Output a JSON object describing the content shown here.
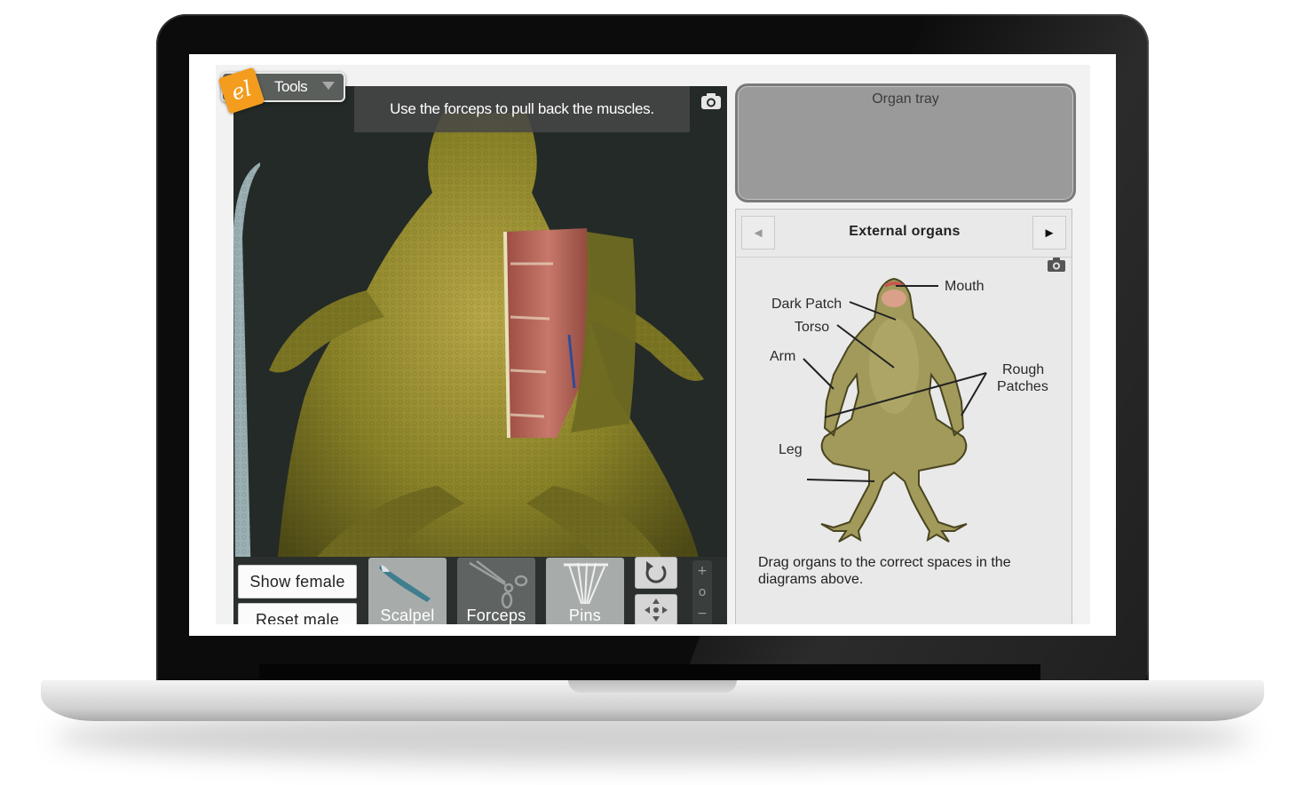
{
  "toolbar": {
    "tools_label": "Tools",
    "logo_text": "el"
  },
  "viewport": {
    "instruction": "Use the forceps to pull back the muscles.",
    "icons": {
      "camera": "camera-icon"
    }
  },
  "controls": {
    "show_female": "Show female",
    "reset_male": "Reset male",
    "tools": [
      {
        "label": "Scalpel",
        "icon": "scalpel-icon"
      },
      {
        "label": "Forceps",
        "icon": "forceps-icon"
      },
      {
        "label": "Pins",
        "icon": "pins-icon"
      }
    ],
    "zoom": {
      "plus": "+",
      "reset": "o",
      "minus": "−"
    }
  },
  "organ_tray": {
    "title": "Organ tray"
  },
  "diagram": {
    "title": "External organs",
    "prev_icon": "◄",
    "next_icon": "►",
    "labels": {
      "mouth": "Mouth",
      "dark_patch": "Dark Patch",
      "torso": "Torso",
      "arm": "Arm",
      "rough_line1": "Rough",
      "rough_line2": "Patches",
      "leg": "Leg"
    },
    "hint": "Drag organs to the correct spaces in the diagrams above."
  },
  "colors": {
    "frog_skin": "#8f8a2e",
    "diagram_frog": "#a09a5a",
    "muscle": "#b8695a",
    "accent_logo": "#f39c1e"
  }
}
